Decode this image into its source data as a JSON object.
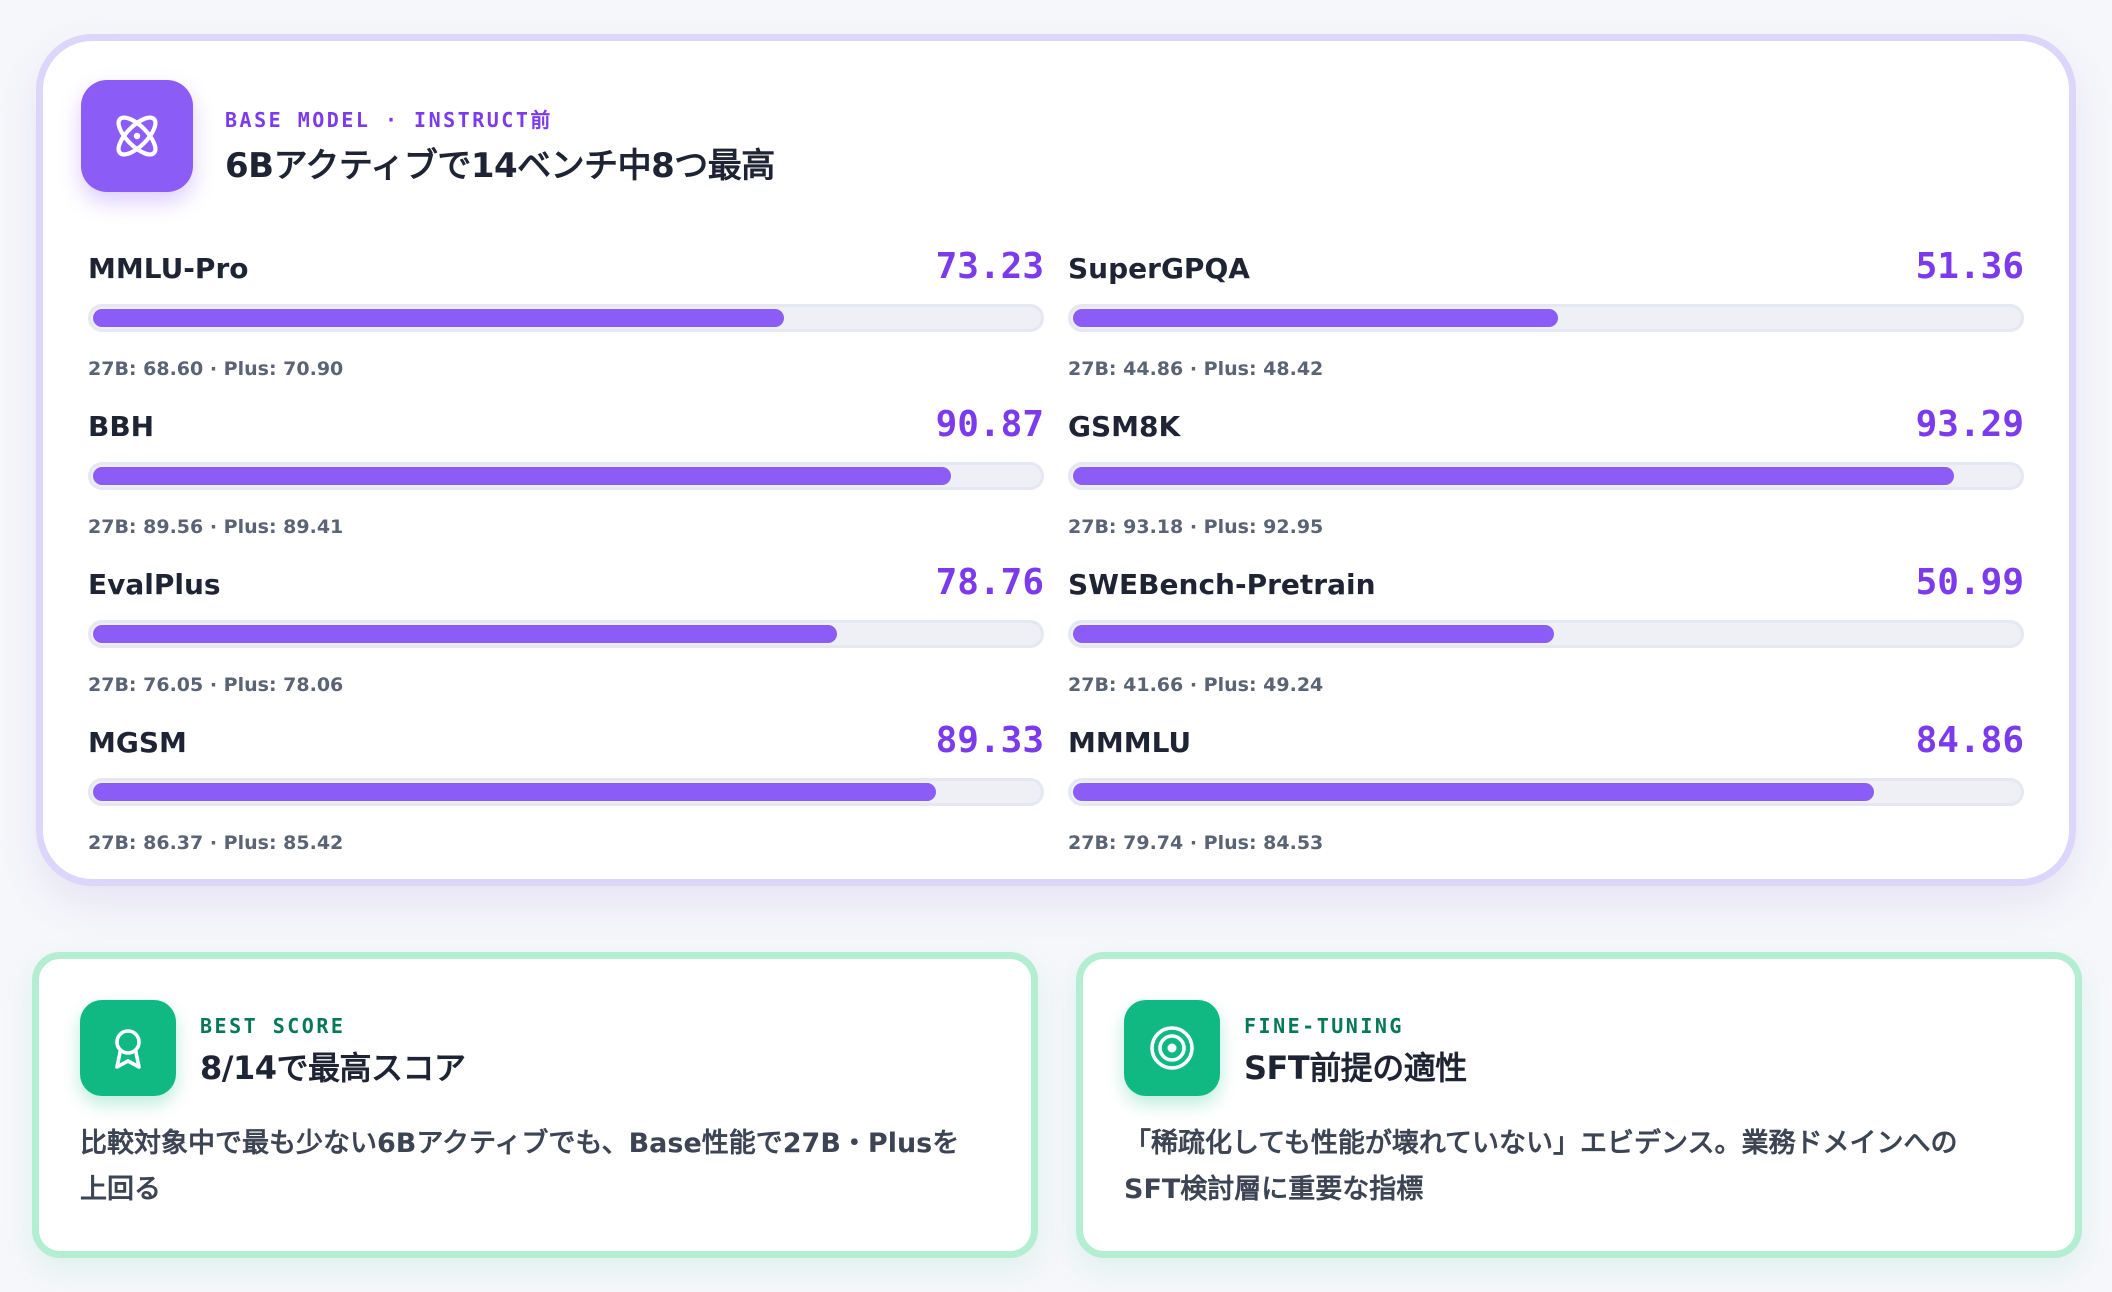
{
  "header": {
    "icon": "atom-icon",
    "eyebrow": "BASE MODEL · INSTRUCT前",
    "title": "6Bアクティブで14ベンチ中8つ最高"
  },
  "colors": {
    "accent": "#8b5cf6",
    "accent_text": "#7c3aed",
    "green": "#10b981",
    "green_text": "#047857"
  },
  "benchmarks": [
    {
      "name": "MMLU-Pro",
      "score": "73.23",
      "value": 73.23,
      "sub": "27B: 68.60 · Plus: 70.90"
    },
    {
      "name": "SuperGPQA",
      "score": "51.36",
      "value": 51.36,
      "sub": "27B: 44.86 · Plus: 48.42"
    },
    {
      "name": "BBH",
      "score": "90.87",
      "value": 90.87,
      "sub": "27B: 89.56 · Plus: 89.41"
    },
    {
      "name": "GSM8K",
      "score": "93.29",
      "value": 93.29,
      "sub": "27B: 93.18 · Plus: 92.95"
    },
    {
      "name": "EvalPlus",
      "score": "78.76",
      "value": 78.76,
      "sub": "27B: 76.05 · Plus: 78.06"
    },
    {
      "name": "SWEBench-Pretrain",
      "score": "50.99",
      "value": 50.99,
      "sub": "27B: 41.66 · Plus: 49.24"
    },
    {
      "name": "MGSM",
      "score": "89.33",
      "value": 89.33,
      "sub": "27B: 86.37 · Plus: 85.42"
    },
    {
      "name": "MMMLU",
      "score": "84.86",
      "value": 84.86,
      "sub": "27B: 79.74 · Plus: 84.53"
    }
  ],
  "cards": [
    {
      "icon": "award-ribbon-icon",
      "eyebrow": "BEST SCORE",
      "title": "8/14で最高スコア",
      "desc": "比較対象中で最も少ない6Bアクティブでも、Base性能で27B・Plusを上回る"
    },
    {
      "icon": "target-icon",
      "eyebrow": "FINE-TUNING",
      "title": "SFT前提の適性",
      "desc": "「稀疏化しても性能が壊れていない」エビデンス。業務ドメインへのSFT検討層に重要な指標"
    }
  ]
}
